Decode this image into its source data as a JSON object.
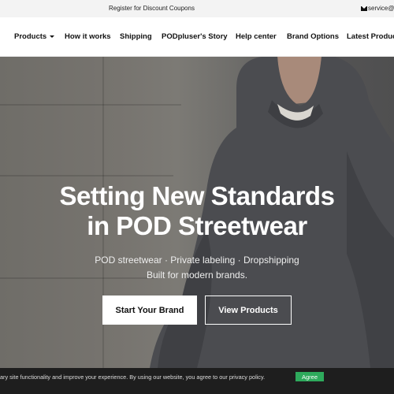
{
  "topbar": {
    "promo": "Register for Discount Coupons",
    "email": "service@p"
  },
  "nav": {
    "products": "Products",
    "how_it_works": "How it works",
    "shipping": "Shipping",
    "story": "PODpluser's Story",
    "help": "Help center",
    "brand_options": "Brand Options",
    "latest": "Latest Product"
  },
  "hero": {
    "title_line1": "Setting New Standards",
    "title_line2": "in POD Streetwear",
    "subtitle_line1": "POD streetwear · Private labeling · Dropshipping",
    "subtitle_line2": "Built for modern brands.",
    "primary_cta": "Start Your Brand",
    "secondary_cta": "View Products"
  },
  "cookie": {
    "text": "ary site functionality and improve your experience. By using our website, you agree to our privacy policy.",
    "agree": "Agree"
  },
  "colors": {
    "accent_green": "#2eaa5c",
    "topbar_bg": "#f3f3f3",
    "cookie_bg": "#1e1e1e"
  },
  "icons": [
    "mail-icon",
    "chevron-down-icon"
  ]
}
